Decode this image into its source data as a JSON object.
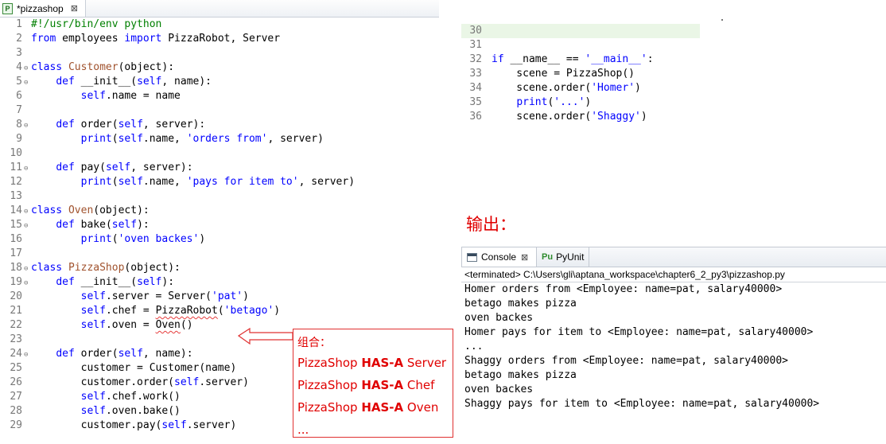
{
  "editor": {
    "tab_title": "*pizzashop",
    "tab_icon": "python-file-icon",
    "tab_close": "⊠"
  },
  "code_left": [
    {
      "n": "1",
      "fold": "",
      "tokens": [
        [
          "cmt",
          "#!/usr/bin/env python"
        ]
      ]
    },
    {
      "n": "2",
      "fold": "",
      "tokens": [
        [
          "kw",
          "from"
        ],
        [
          "",
          " employees "
        ],
        [
          "kw",
          "import"
        ],
        [
          "",
          " PizzaRobot, Server"
        ]
      ]
    },
    {
      "n": "3",
      "fold": "",
      "tokens": []
    },
    {
      "n": "4",
      "fold": "⊖",
      "tokens": [
        [
          "kw",
          "class"
        ],
        [
          "",
          " "
        ],
        [
          "cls",
          "Customer"
        ],
        [
          "",
          "(object):"
        ]
      ]
    },
    {
      "n": "5",
      "fold": "⊖",
      "tokens": [
        [
          "",
          "    "
        ],
        [
          "kw",
          "def"
        ],
        [
          "",
          " "
        ],
        [
          "fn",
          "__init__"
        ],
        [
          "",
          "("
        ],
        [
          "self",
          "self"
        ],
        [
          "",
          ", name):"
        ]
      ]
    },
    {
      "n": "6",
      "fold": "",
      "tokens": [
        [
          "",
          "        "
        ],
        [
          "self",
          "self"
        ],
        [
          "",
          ".name = name"
        ]
      ]
    },
    {
      "n": "7",
      "fold": "",
      "tokens": []
    },
    {
      "n": "8",
      "fold": "⊖",
      "tokens": [
        [
          "",
          "    "
        ],
        [
          "kw",
          "def"
        ],
        [
          "",
          " "
        ],
        [
          "fn",
          "order"
        ],
        [
          "",
          "("
        ],
        [
          "self",
          "self"
        ],
        [
          "",
          ", server):"
        ]
      ]
    },
    {
      "n": "9",
      "fold": "",
      "tokens": [
        [
          "",
          "        "
        ],
        [
          "kw",
          "print"
        ],
        [
          "",
          "("
        ],
        [
          "self",
          "self"
        ],
        [
          "",
          ".name, "
        ],
        [
          "str",
          "'orders from'"
        ],
        [
          "",
          ", server)"
        ]
      ]
    },
    {
      "n": "10",
      "fold": "",
      "tokens": []
    },
    {
      "n": "11",
      "fold": "⊖",
      "tokens": [
        [
          "",
          "    "
        ],
        [
          "kw",
          "def"
        ],
        [
          "",
          " "
        ],
        [
          "fn",
          "pay"
        ],
        [
          "",
          "("
        ],
        [
          "self",
          "self"
        ],
        [
          "",
          ", server):"
        ]
      ]
    },
    {
      "n": "12",
      "fold": "",
      "tokens": [
        [
          "",
          "        "
        ],
        [
          "kw",
          "print"
        ],
        [
          "",
          "("
        ],
        [
          "self",
          "self"
        ],
        [
          "",
          ".name, "
        ],
        [
          "str",
          "'pays for item to'"
        ],
        [
          "",
          ", server)"
        ]
      ]
    },
    {
      "n": "13",
      "fold": "",
      "tokens": []
    },
    {
      "n": "14",
      "fold": "⊖",
      "tokens": [
        [
          "kw",
          "class"
        ],
        [
          "",
          " "
        ],
        [
          "cls",
          "Oven"
        ],
        [
          "",
          "(object):"
        ]
      ]
    },
    {
      "n": "15",
      "fold": "⊖",
      "tokens": [
        [
          "",
          "    "
        ],
        [
          "kw",
          "def"
        ],
        [
          "",
          " "
        ],
        [
          "fn",
          "bake"
        ],
        [
          "",
          "("
        ],
        [
          "self",
          "self"
        ],
        [
          "",
          "):"
        ]
      ]
    },
    {
      "n": "16",
      "fold": "",
      "tokens": [
        [
          "",
          "        "
        ],
        [
          "kw",
          "print"
        ],
        [
          "",
          "("
        ],
        [
          "str",
          "'oven backes'"
        ],
        [
          "",
          ")"
        ]
      ]
    },
    {
      "n": "17",
      "fold": "",
      "tokens": []
    },
    {
      "n": "18",
      "fold": "⊖",
      "tokens": [
        [
          "kw",
          "class"
        ],
        [
          "",
          " "
        ],
        [
          "cls",
          "PizzaShop"
        ],
        [
          "",
          "(object):"
        ]
      ]
    },
    {
      "n": "19",
      "fold": "⊖",
      "tokens": [
        [
          "",
          "    "
        ],
        [
          "kw",
          "def"
        ],
        [
          "",
          " "
        ],
        [
          "fn",
          "__init__"
        ],
        [
          "",
          "("
        ],
        [
          "self",
          "self"
        ],
        [
          "",
          "):"
        ]
      ]
    },
    {
      "n": "20",
      "fold": "",
      "tokens": [
        [
          "",
          "        "
        ],
        [
          "self",
          "self"
        ],
        [
          "",
          ".server = Server("
        ],
        [
          "str",
          "'pat'"
        ],
        [
          "",
          ")"
        ]
      ]
    },
    {
      "n": "21",
      "fold": "",
      "tokens": [
        [
          "",
          "        "
        ],
        [
          "self",
          "self"
        ],
        [
          "",
          ".chef = "
        ],
        [
          "squig",
          "PizzaRobot"
        ],
        [
          "",
          "("
        ],
        [
          "str",
          "'betago'"
        ],
        [
          "",
          ")"
        ]
      ]
    },
    {
      "n": "22",
      "fold": "",
      "tokens": [
        [
          "",
          "        "
        ],
        [
          "self",
          "self"
        ],
        [
          "",
          ".oven = "
        ],
        [
          "squig",
          "Oven"
        ],
        [
          "",
          "()"
        ]
      ]
    },
    {
      "n": "23",
      "fold": "",
      "tokens": []
    },
    {
      "n": "24",
      "fold": "⊖",
      "tokens": [
        [
          "",
          "    "
        ],
        [
          "kw",
          "def"
        ],
        [
          "",
          " "
        ],
        [
          "fn",
          "order"
        ],
        [
          "",
          "("
        ],
        [
          "self",
          "self"
        ],
        [
          "",
          ", name):"
        ]
      ]
    },
    {
      "n": "25",
      "fold": "",
      "tokens": [
        [
          "",
          "        customer = Customer(name)"
        ]
      ]
    },
    {
      "n": "26",
      "fold": "",
      "tokens": [
        [
          "",
          "        customer.order("
        ],
        [
          "self",
          "self"
        ],
        [
          "",
          ".server)"
        ]
      ]
    },
    {
      "n": "27",
      "fold": "",
      "tokens": [
        [
          "",
          "        "
        ],
        [
          "self",
          "self"
        ],
        [
          "",
          ".chef.work()"
        ]
      ]
    },
    {
      "n": "28",
      "fold": "",
      "tokens": [
        [
          "",
          "        "
        ],
        [
          "self",
          "self"
        ],
        [
          "",
          ".oven.bake()"
        ]
      ]
    },
    {
      "n": "29",
      "fold": "",
      "tokens": [
        [
          "",
          "        customer.pay("
        ],
        [
          "self",
          "self"
        ],
        [
          "",
          ".server)"
        ]
      ]
    }
  ],
  "code_right": [
    {
      "n": "30",
      "hl": true,
      "tokens": []
    },
    {
      "n": "31",
      "hl": false,
      "tokens": []
    },
    {
      "n": "32",
      "hl": false,
      "tokens": [
        [
          "kw",
          "if"
        ],
        [
          "",
          " __name__ == "
        ],
        [
          "str",
          "'__main__'"
        ],
        [
          "",
          ":"
        ]
      ]
    },
    {
      "n": "33",
      "hl": false,
      "tokens": [
        [
          "",
          "    scene = PizzaShop()"
        ]
      ]
    },
    {
      "n": "34",
      "hl": false,
      "tokens": [
        [
          "",
          "    scene.order("
        ],
        [
          "str",
          "'Homer'"
        ],
        [
          "",
          ")"
        ]
      ]
    },
    {
      "n": "35",
      "hl": false,
      "tokens": [
        [
          "",
          "    "
        ],
        [
          "kw",
          "print"
        ],
        [
          "",
          "("
        ],
        [
          "str",
          "'...'"
        ],
        [
          "",
          ")"
        ]
      ]
    },
    {
      "n": "36",
      "hl": false,
      "tokens": [
        [
          "",
          "    scene.order("
        ],
        [
          "str",
          "'Shaggy'"
        ],
        [
          "",
          ")"
        ]
      ]
    }
  ],
  "output_label": "输出：",
  "console": {
    "tab_console": "Console",
    "tab_console_close": "⊠",
    "tab_pyunit": "PyUnit",
    "terminated": "<terminated> C:\\Users\\gli\\aptana_workspace\\chapter6_2_py3\\pizzashop.py",
    "lines": [
      "Homer orders from <Employee: name=pat, salary40000>",
      "betago makes pizza",
      "oven backes",
      "Homer pays for item to <Employee: name=pat, salary40000>",
      "...",
      "Shaggy orders from <Employee: name=pat, salary40000>",
      "betago makes pizza",
      "oven backes",
      "Shaggy pays for item to <Employee: name=pat, salary40000>"
    ]
  },
  "annotation": {
    "title": "组合：",
    "rows": [
      {
        "pre": "PizzaShop ",
        "bold": "HAS-A",
        "post": " Server"
      },
      {
        "pre": "PizzaShop ",
        "bold": "HAS-A",
        "post": " Chef"
      },
      {
        "pre": "PizzaShop ",
        "bold": "HAS-A",
        "post": " Oven"
      }
    ],
    "ellipsis": "..."
  },
  "colors": {
    "keyword": "#0000ff",
    "class_name": "#a0522d",
    "comment": "#007f00",
    "annotation": "#e00000",
    "highlight_line": "#eaf6e6"
  }
}
